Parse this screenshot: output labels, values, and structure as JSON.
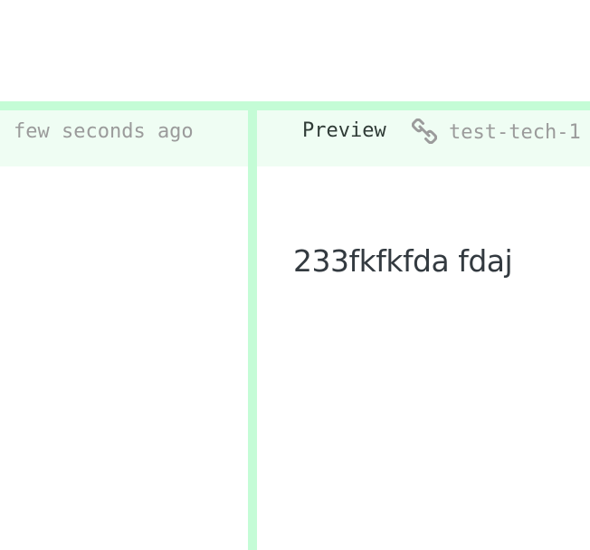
{
  "history": {
    "timestamp": "few seconds ago"
  },
  "preview": {
    "label": "Preview",
    "link_icon": "link-icon",
    "doc_name": "test-tech-1",
    "content": "233fkfkfda fdaj"
  },
  "colors": {
    "border_accent": "#c4fcd6",
    "header_background": "#effdf3",
    "muted_text": "#9b9b9b",
    "body_text": "#333a40"
  }
}
